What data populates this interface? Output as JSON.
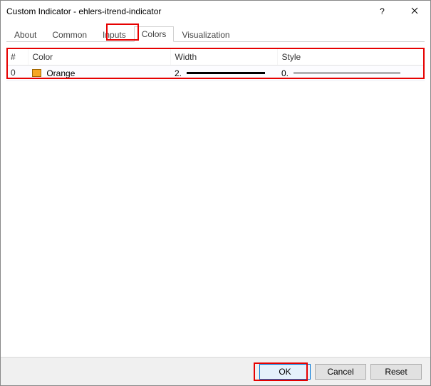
{
  "titlebar": {
    "title": "Custom Indicator - ehlers-itrend-indicator"
  },
  "tabs": {
    "about": "About",
    "common": "Common",
    "inputs": "Inputs",
    "colors": "Colors",
    "visualization": "Visualization"
  },
  "table": {
    "headers": {
      "index": "#",
      "color": "Color",
      "width": "Width",
      "style": "Style"
    },
    "rows": [
      {
        "index": "0",
        "color_name": "Orange",
        "color_hex": "#f5a623",
        "width_value": "2.",
        "style_value": "0."
      }
    ]
  },
  "buttons": {
    "ok": "OK",
    "cancel": "Cancel",
    "reset": "Reset"
  }
}
